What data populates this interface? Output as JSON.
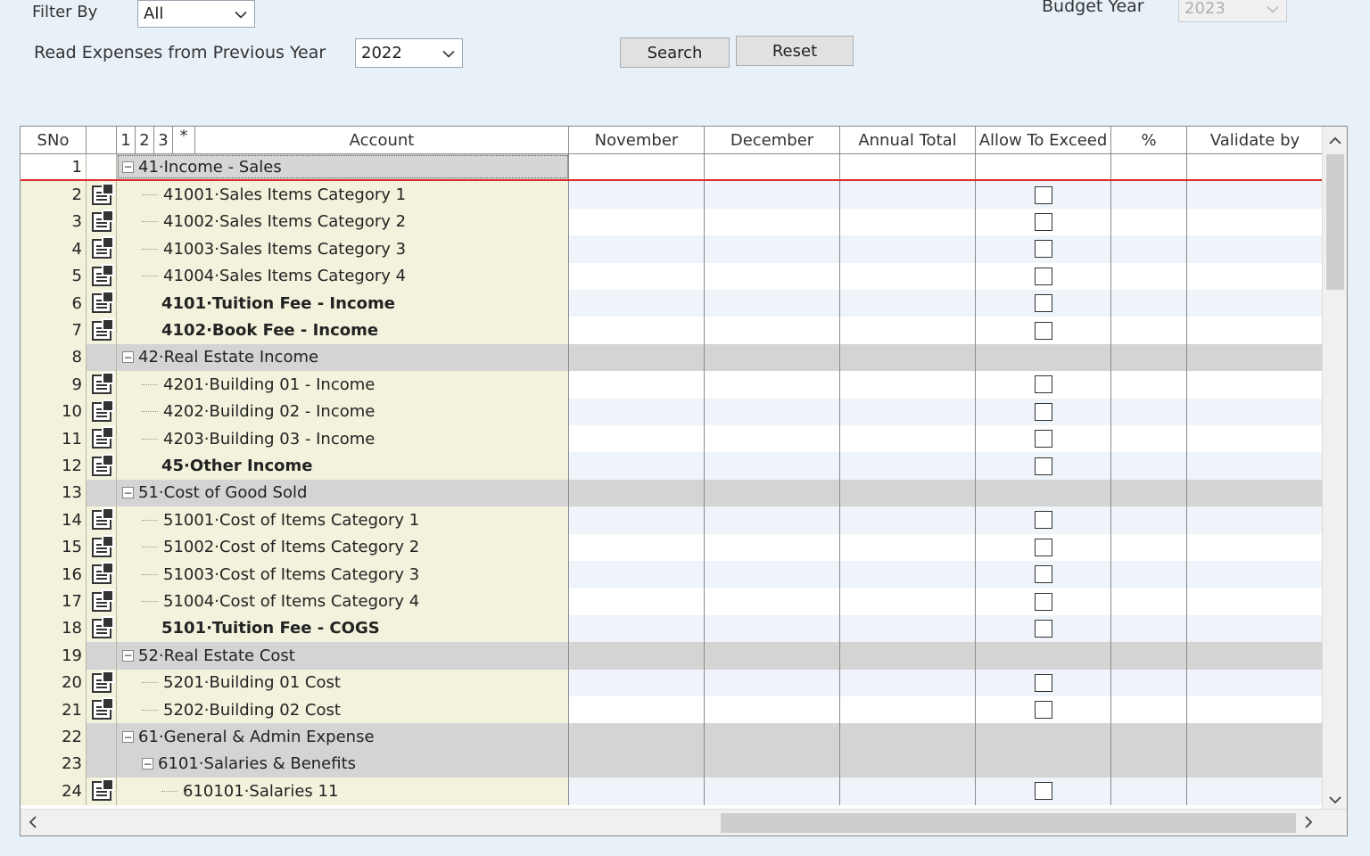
{
  "filters": {
    "filter_by_label": "Filter By",
    "filter_by_value": "All",
    "read_expenses_label": "Read Expenses from Previous Year",
    "read_expenses_value": "2022",
    "budget_year_label": "Budget Year",
    "budget_year_value": "2023"
  },
  "buttons": {
    "search": "Search",
    "reset": "Reset"
  },
  "grid": {
    "columns": {
      "sno": "SNo",
      "l1": "1",
      "l2": "2",
      "l3": "3",
      "lstar": "*",
      "account": "Account",
      "november": "November",
      "december": "December",
      "annual_total": "Annual Total",
      "allow_to_exceed": "Allow To Exceed",
      "percent": "%",
      "validate_by": "Validate by"
    },
    "rows": [
      {
        "sno": "1",
        "account": "41·Income - Sales",
        "type": "group",
        "indent": 0,
        "first": true
      },
      {
        "sno": "2",
        "account": "41001·Sales Items Category 1",
        "type": "leaf",
        "indent": 1
      },
      {
        "sno": "3",
        "account": "41002·Sales Items Category 2",
        "type": "leaf",
        "indent": 1
      },
      {
        "sno": "4",
        "account": "41003·Sales Items Category 3",
        "type": "leaf",
        "indent": 1
      },
      {
        "sno": "5",
        "account": "41004·Sales Items Category 4",
        "type": "leaf",
        "indent": 1
      },
      {
        "sno": "6",
        "account": "4101·Tuition Fee - Income",
        "type": "bold",
        "indent": 0
      },
      {
        "sno": "7",
        "account": "4102·Book Fee - Income",
        "type": "bold",
        "indent": 0
      },
      {
        "sno": "8",
        "account": "42·Real Estate Income",
        "type": "group",
        "indent": 0
      },
      {
        "sno": "9",
        "account": "4201·Building 01 - Income",
        "type": "leaf",
        "indent": 1
      },
      {
        "sno": "10",
        "account": "4202·Building 02 - Income",
        "type": "leaf",
        "indent": 1
      },
      {
        "sno": "11",
        "account": "4203·Building 03 - Income",
        "type": "leaf",
        "indent": 1
      },
      {
        "sno": "12",
        "account": "45·Other Income",
        "type": "bold",
        "indent": 0
      },
      {
        "sno": "13",
        "account": "51·Cost of Good Sold",
        "type": "group",
        "indent": 0
      },
      {
        "sno": "14",
        "account": "51001·Cost of Items Category 1",
        "type": "leaf",
        "indent": 1
      },
      {
        "sno": "15",
        "account": "51002·Cost of Items Category 2",
        "type": "leaf",
        "indent": 1
      },
      {
        "sno": "16",
        "account": "51003·Cost of Items Category 3",
        "type": "leaf",
        "indent": 1
      },
      {
        "sno": "17",
        "account": "51004·Cost of Items Category 4",
        "type": "leaf",
        "indent": 1
      },
      {
        "sno": "18",
        "account": "5101·Tuition Fee - COGS",
        "type": "bold",
        "indent": 0
      },
      {
        "sno": "19",
        "account": "52·Real Estate Cost",
        "type": "group",
        "indent": 0
      },
      {
        "sno": "20",
        "account": "5201·Building 01 Cost",
        "type": "leaf",
        "indent": 1
      },
      {
        "sno": "21",
        "account": "5202·Building 02 Cost",
        "type": "leaf",
        "indent": 1
      },
      {
        "sno": "22",
        "account": "61·General & Admin Expense",
        "type": "group",
        "indent": 0
      },
      {
        "sno": "23",
        "account": "6101·Salaries & Benefits",
        "type": "group",
        "indent": 1
      },
      {
        "sno": "24",
        "account": "610101·Salaries 11",
        "type": "leaf",
        "indent": 2
      }
    ]
  },
  "icons": {
    "dropdown": "chevron-down-icon",
    "collapse": "minus-box-icon",
    "row_detail": "document-detail-icon",
    "scroll_up": "chevron-up-icon",
    "scroll_down": "chevron-down-icon",
    "scroll_left": "chevron-left-icon",
    "scroll_right": "chevron-right-icon"
  }
}
